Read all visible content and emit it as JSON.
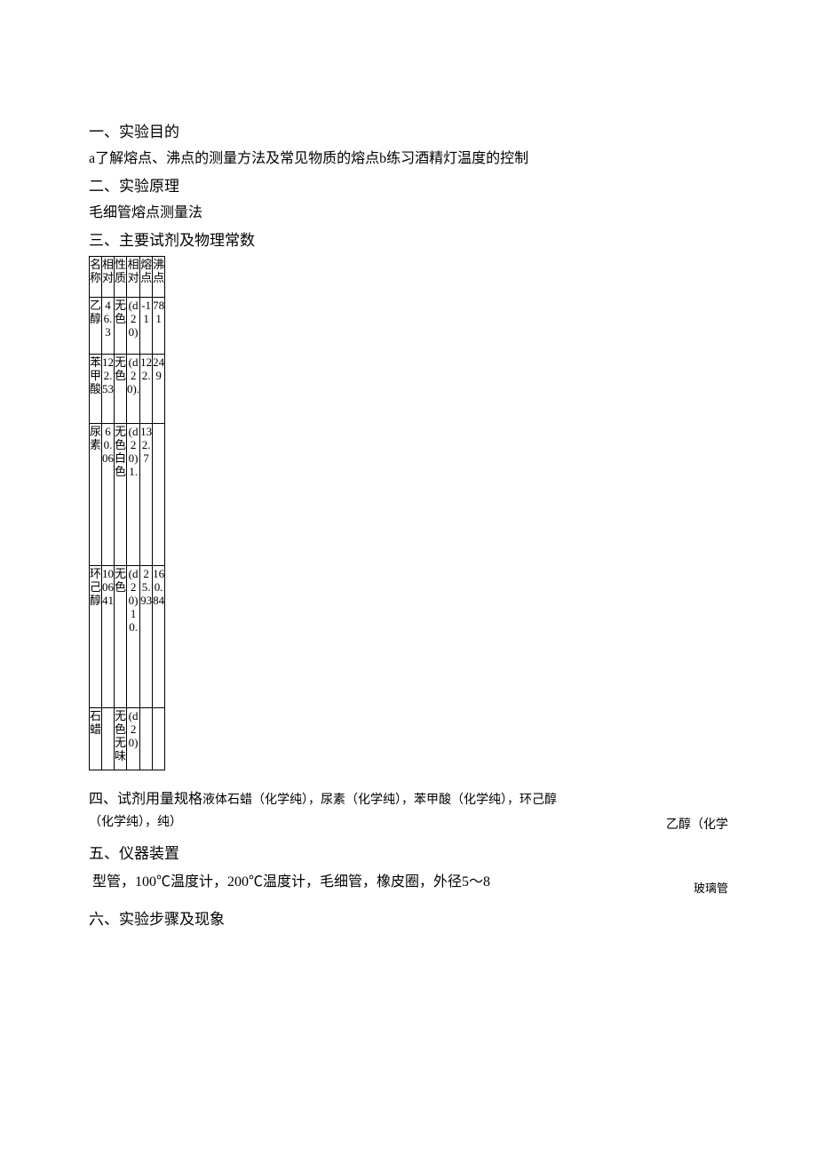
{
  "sec1": {
    "title": "一、实验目的",
    "body": "a了解熔点、沸点的测量方法及常见物质的熔点b练习酒精灯温度的控制"
  },
  "sec2": {
    "title": "二、实验原理",
    "body": "毛细管熔点测量法"
  },
  "sec3": {
    "title": "三、主要试剂及物理常数",
    "table": {
      "head": [
        "名称",
        "相对",
        "性质",
        "相对",
        "熔点",
        "沸点"
      ],
      "rows": [
        [
          "乙醇",
          "46.3",
          "无色",
          "(d20)",
          "-11",
          "781"
        ],
        [
          "苯甲酸",
          "122.53",
          "无色",
          "(d20).",
          "122.",
          "249"
        ],
        [
          "尿素",
          "60.06",
          "无色白色",
          "(d20)1.",
          "132.7",
          ""
        ],
        [
          "环己醇",
          "100641",
          "无色",
          "(d20)10.",
          "25.93",
          "160.84"
        ],
        [
          "石蜡",
          "",
          "无色无味",
          "(d20)",
          "",
          ""
        ]
      ]
    }
  },
  "sec4": {
    "lead": "四、试剂用量规格",
    "body1": "液体石蜡（化学纯），尿素（化学纯），苯甲酸（化学纯），环己醇",
    "body2": "（化学纯），纯）",
    "right": "乙醇（化学"
  },
  "sec5": {
    "title": "五、仪器装置",
    "body": " 型管，100℃温度计，200℃温度计，毛细管，橡皮圈，外径5〜8",
    "right": "玻璃管"
  },
  "sec6": {
    "title": "六、实验步骤及现象"
  }
}
